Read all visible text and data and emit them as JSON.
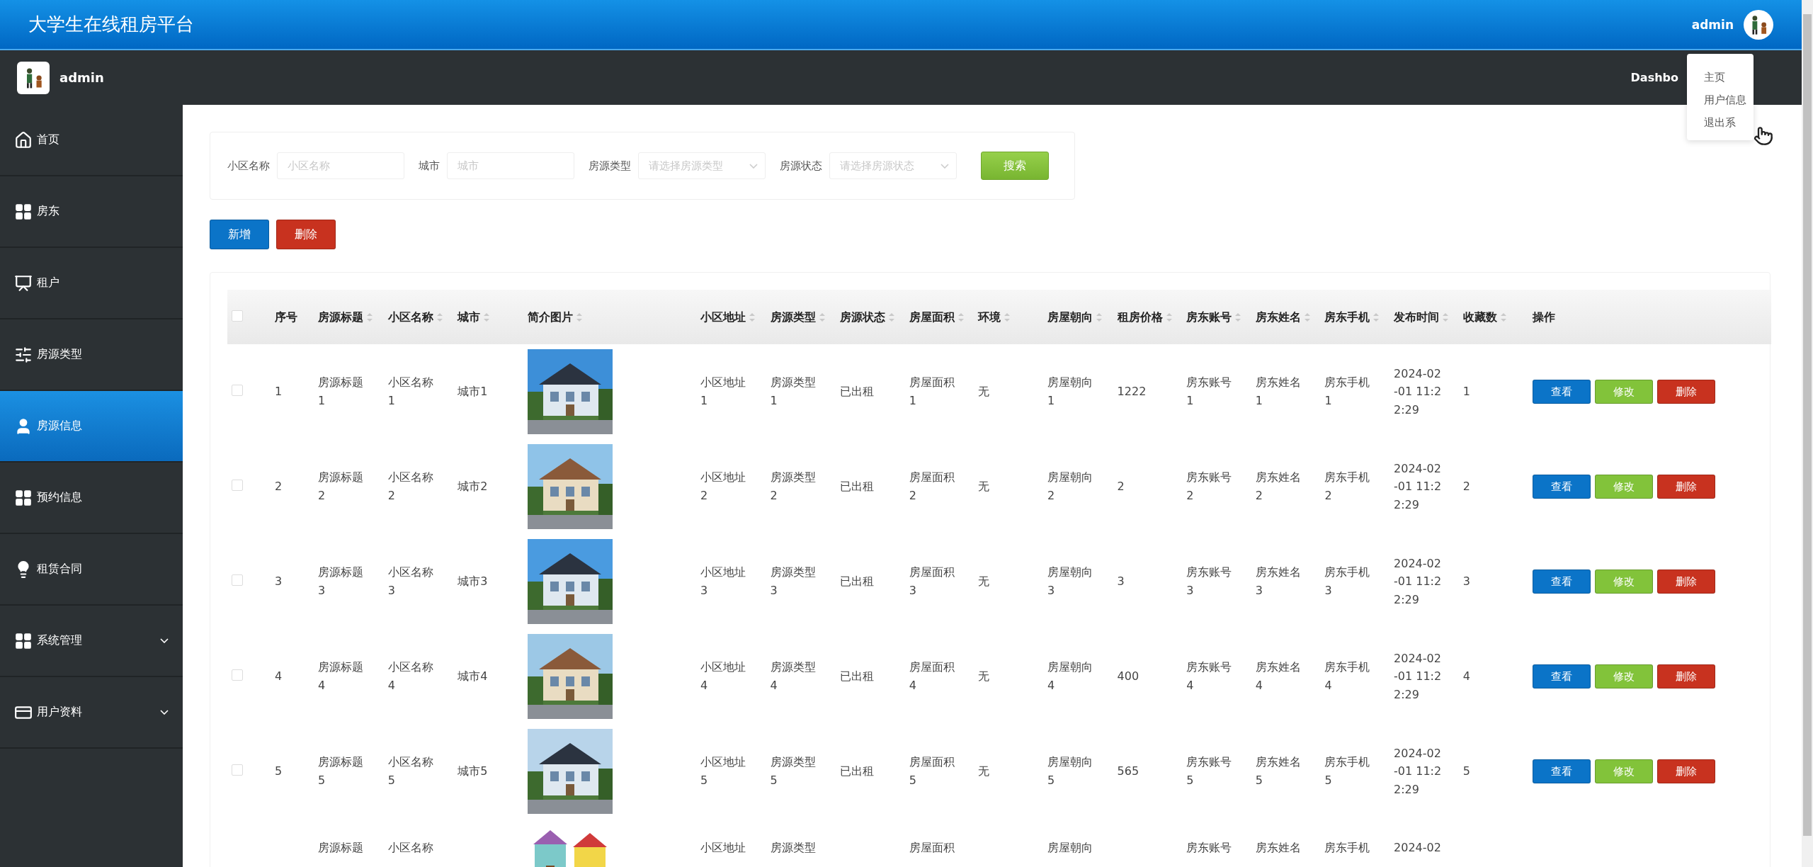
{
  "header": {
    "title": "大学生在线租房平台",
    "user": "admin"
  },
  "user_menu": {
    "items": [
      "主页",
      "用户信息",
      "退出系"
    ]
  },
  "subbar": {
    "user": "admin",
    "link": "Dashbo"
  },
  "sidebar": {
    "items": [
      {
        "label": "首页",
        "selected": false,
        "expandable": false
      },
      {
        "label": "房东",
        "selected": false,
        "expandable": false
      },
      {
        "label": "租户",
        "selected": false,
        "expandable": false
      },
      {
        "label": "房源类型",
        "selected": false,
        "expandable": false
      },
      {
        "label": "房源信息",
        "selected": true,
        "expandable": false
      },
      {
        "label": "预约信息",
        "selected": false,
        "expandable": false
      },
      {
        "label": "租赁合同",
        "selected": false,
        "expandable": false
      },
      {
        "label": "系统管理",
        "selected": false,
        "expandable": true
      },
      {
        "label": "用户资料",
        "selected": false,
        "expandable": true
      }
    ]
  },
  "search": {
    "fields": [
      {
        "label": "小区名称",
        "kind": "input",
        "placeholder": "小区名称"
      },
      {
        "label": "城市",
        "kind": "input",
        "placeholder": "城市"
      },
      {
        "label": "房源类型",
        "kind": "select",
        "placeholder": "请选择房源类型"
      },
      {
        "label": "房源状态",
        "kind": "select",
        "placeholder": "请选择房源状态"
      }
    ],
    "button": "搜索"
  },
  "actions": [
    {
      "label": "新增",
      "kind": "primary"
    },
    {
      "label": "删除",
      "kind": "danger"
    }
  ],
  "table": {
    "all_checked": false,
    "columns": [
      {
        "label": "序号",
        "kind": "text",
        "sortable": false
      },
      {
        "label": "房源标题",
        "kind": "text",
        "sortable": true
      },
      {
        "label": "小区名称",
        "kind": "text",
        "sortable": true
      },
      {
        "label": "城市",
        "kind": "text",
        "sortable": true
      },
      {
        "label": "简介图片",
        "kind": "picture",
        "sortable": true
      },
      {
        "label": "小区地址",
        "kind": "text",
        "sortable": true
      },
      {
        "label": "房源类型",
        "kind": "text",
        "sortable": true
      },
      {
        "label": "房源状态",
        "kind": "text",
        "sortable": true
      },
      {
        "label": "房屋面积",
        "kind": "text",
        "sortable": true
      },
      {
        "label": "环境",
        "kind": "text",
        "sortable": true
      },
      {
        "label": "房屋朝向",
        "kind": "text",
        "sortable": true
      },
      {
        "label": "租房价格",
        "kind": "text",
        "sortable": true
      },
      {
        "label": "房东账号",
        "kind": "text",
        "sortable": true
      },
      {
        "label": "房东姓名",
        "kind": "text",
        "sortable": true
      },
      {
        "label": "房东手机",
        "kind": "text",
        "sortable": true
      },
      {
        "label": "发布时间",
        "kind": "text",
        "sortable": true
      },
      {
        "label": "收藏数",
        "kind": "text",
        "sortable": true
      },
      {
        "label": "操作",
        "kind": "actions",
        "sortable": false
      }
    ],
    "rows": [
      {
        "checked": false,
        "cells": [
          "1",
          "房源标题1",
          "小区名称1",
          "城市1",
          "",
          "小区地址1",
          "房源类型1",
          "已出租",
          "房屋面积1",
          "无",
          "房屋朝向1",
          "1222",
          "房东账号1",
          "房东姓名1",
          "房东手机1",
          "2024-02-01 11:22:29",
          "1"
        ],
        "actions": [
          {
            "label": "查看",
            "kind": "view"
          },
          {
            "label": "修改",
            "kind": "edit"
          },
          {
            "label": "删除",
            "kind": "delete"
          }
        ]
      },
      {
        "checked": false,
        "cells": [
          "2",
          "房源标题2",
          "小区名称2",
          "城市2",
          "",
          "小区地址2",
          "房源类型2",
          "已出租",
          "房屋面积2",
          "无",
          "房屋朝向2",
          "2",
          "房东账号2",
          "房东姓名2",
          "房东手机2",
          "2024-02-01 11:22:29",
          "2"
        ],
        "actions": [
          {
            "label": "查看",
            "kind": "view"
          },
          {
            "label": "修改",
            "kind": "edit"
          },
          {
            "label": "删除",
            "kind": "delete"
          }
        ]
      },
      {
        "checked": false,
        "cells": [
          "3",
          "房源标题3",
          "小区名称3",
          "城市3",
          "",
          "小区地址3",
          "房源类型3",
          "已出租",
          "房屋面积3",
          "无",
          "房屋朝向3",
          "3",
          "房东账号3",
          "房东姓名3",
          "房东手机3",
          "2024-02-01 11:22:29",
          "3"
        ],
        "actions": [
          {
            "label": "查看",
            "kind": "view"
          },
          {
            "label": "修改",
            "kind": "edit"
          },
          {
            "label": "删除",
            "kind": "delete"
          }
        ]
      },
      {
        "checked": false,
        "cells": [
          "4",
          "房源标题4",
          "小区名称4",
          "城市4",
          "",
          "小区地址4",
          "房源类型4",
          "已出租",
          "房屋面积4",
          "无",
          "房屋朝向4",
          "400",
          "房东账号4",
          "房东姓名4",
          "房东手机4",
          "2024-02-01 11:22:29",
          "4"
        ],
        "actions": [
          {
            "label": "查看",
            "kind": "view"
          },
          {
            "label": "修改",
            "kind": "edit"
          },
          {
            "label": "删除",
            "kind": "delete"
          }
        ]
      },
      {
        "checked": false,
        "cells": [
          "5",
          "房源标题5",
          "小区名称5",
          "城市5",
          "",
          "小区地址5",
          "房源类型5",
          "已出租",
          "房屋面积5",
          "无",
          "房屋朝向5",
          "565",
          "房东账号5",
          "房东姓名5",
          "房东手机5",
          "2024-02-01 11:22:29",
          "5"
        ],
        "actions": [
          {
            "label": "查看",
            "kind": "view"
          },
          {
            "label": "修改",
            "kind": "edit"
          },
          {
            "label": "删除",
            "kind": "delete"
          }
        ]
      },
      {
        "cells": [
          "",
          "房源标题",
          "小区名称",
          "",
          "",
          "小区地址",
          "房源类型",
          "",
          "房屋面积",
          "",
          "房屋朝向",
          "",
          "房东账号",
          "房东姓名",
          "房东手机",
          "2024-02",
          ""
        ]
      }
    ]
  }
}
